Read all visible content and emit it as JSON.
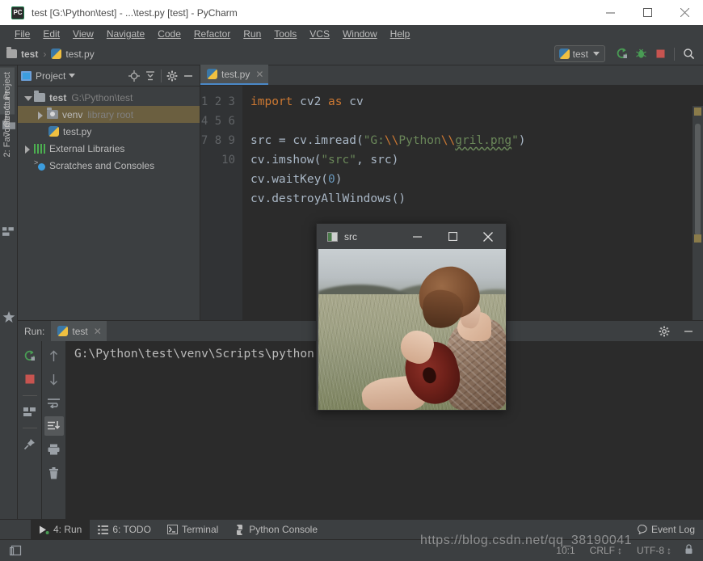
{
  "window": {
    "title": "test [G:\\Python\\test] - ...\\test.py [test] - PyCharm",
    "app_icon": "pycharm-icon",
    "minimize": "—",
    "maximize": "□",
    "close": "✕"
  },
  "menubar": {
    "items": [
      {
        "label": "File"
      },
      {
        "label": "Edit"
      },
      {
        "label": "View"
      },
      {
        "label": "Navigate"
      },
      {
        "label": "Code"
      },
      {
        "label": "Refactor"
      },
      {
        "label": "Run"
      },
      {
        "label": "Tools"
      },
      {
        "label": "VCS"
      },
      {
        "label": "Window"
      },
      {
        "label": "Help"
      }
    ]
  },
  "navbar": {
    "breadcrumb": [
      {
        "label": "test",
        "icon": "folder-icon"
      },
      {
        "label": "test.py",
        "icon": "python-file-icon"
      }
    ],
    "separator": "›",
    "run_config": {
      "label": "test",
      "icon": "python-config-icon",
      "caret": "▾"
    },
    "buttons": [
      {
        "name": "run-button",
        "icon": "run-arrow-icon"
      },
      {
        "name": "debug-button",
        "icon": "debug-bug-icon"
      },
      {
        "name": "stop-button",
        "icon": "stop-square-icon"
      },
      {
        "name": "search-everywhere-button",
        "icon": "search-icon"
      }
    ]
  },
  "left_strip": {
    "tabs": [
      {
        "label": "1: Project",
        "key": "1",
        "active": true
      },
      {
        "label": "7: Structure",
        "key": "7",
        "active": false
      },
      {
        "label": "2: Favorites",
        "key": "2",
        "active": false
      }
    ]
  },
  "project_panel": {
    "title": "Project",
    "caret": "▾",
    "header_buttons": [
      "locate-target-icon",
      "collapse-all-icon",
      "gear-icon",
      "hide-icon"
    ],
    "tree": [
      {
        "label": "test",
        "detail": "G:\\Python\\test",
        "icon": "folder-icon",
        "arrow": "down",
        "indent": 0,
        "selected": false,
        "bold": true
      },
      {
        "label": "venv",
        "detail": "library root",
        "icon": "venv-folder-icon",
        "arrow": "right",
        "indent": 1,
        "selected": true,
        "bold": false
      },
      {
        "label": "test.py",
        "detail": "",
        "icon": "python-file-icon",
        "arrow": "none",
        "indent": 1,
        "selected": false,
        "bold": false
      },
      {
        "label": "External Libraries",
        "detail": "",
        "icon": "libraries-icon",
        "arrow": "right",
        "indent": 0,
        "selected": false,
        "bold": false
      },
      {
        "label": "Scratches and Consoles",
        "detail": "",
        "icon": "scratches-icon",
        "arrow": "none",
        "indent": 0,
        "selected": false,
        "bold": false
      }
    ]
  },
  "editor": {
    "tab": {
      "label": "test.py",
      "icon": "python-file-icon",
      "close": "✕"
    },
    "line_numbers": [
      "1",
      "2",
      "3",
      "4",
      "5",
      "6",
      "7",
      "8",
      "9",
      "10"
    ],
    "code_lines": [
      "import cv2 as cv",
      "",
      "src = cv.imread(\"G:\\\\Python\\\\gril.png\")",
      "cv.imshow(\"src\", src)",
      "cv.waitKey(0)",
      "cv.destroyAllWindows()",
      "",
      "",
      "",
      ""
    ]
  },
  "run_panel": {
    "label": "Run:",
    "tab": {
      "label": "test",
      "icon": "python-config-icon",
      "close": "✕"
    },
    "header_buttons": [
      "gear-icon",
      "hide-icon"
    ],
    "left_tools": [
      "rerun-icon",
      "stop-icon",
      "layout-icon",
      "pin-icon"
    ],
    "right_tools": [
      "up-arrow-icon",
      "down-arrow-icon",
      "soft-wrap-icon",
      "scroll-to-end-icon",
      "print-icon",
      "trash-icon"
    ],
    "console_output": "G:\\Python\\test\\venv\\Scripts\\python.exe G:/Python/test/test.py"
  },
  "bottom_tabs": [
    {
      "label": "4: Run",
      "key": "4",
      "icon": "run-arrow-icon",
      "active": true
    },
    {
      "label": "6: TODO",
      "key": "6",
      "icon": "todo-list-icon",
      "active": false
    },
    {
      "label": "Terminal",
      "key": "",
      "icon": "terminal-icon",
      "active": false
    },
    {
      "label": "Python Console",
      "key": "",
      "icon": "python-console-icon",
      "active": false
    }
  ],
  "event_log": {
    "label": "Event Log",
    "icon": "balloon-icon"
  },
  "statusbar": {
    "left_icon": "layout-toggle-icon",
    "caret_position": "10:1",
    "line_separator": "CRLF",
    "line_separator_caret": "↕",
    "encoding": "UTF-8",
    "encoding_caret": "↕",
    "watermark": "https://blog.csdn.net/qq_38190041"
  },
  "cv_window": {
    "title": "src",
    "icon": "image-icon",
    "minimize": "—",
    "maximize": "□",
    "close": "✕",
    "image_description": "woman sitting in a grassy field playing an acoustic guitar"
  },
  "colors": {
    "ide_background": "#3c3f41",
    "editor_background": "#2b2b2b",
    "titlebar_background": "#ffffff",
    "text": "#bbbbbb",
    "keyword": "#cc7832",
    "string": "#6a8759",
    "number": "#6897bb",
    "code_default": "#a9b7c6",
    "selection": "#6b5f40",
    "accent_blue": "#4a88c7",
    "run_green": "#499c54",
    "stop_red": "#c75450"
  }
}
